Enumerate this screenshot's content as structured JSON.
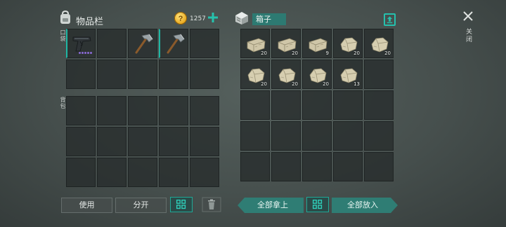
{
  "inventory": {
    "title": "物品栏",
    "gold": "1257",
    "pocket_label": "口袋",
    "backpack_label": "背包",
    "pocket_slots": [
      {
        "item": "pistol",
        "qty": "",
        "selected": true
      },
      {
        "item": "",
        "qty": ""
      },
      {
        "item": "hatchet",
        "qty": ""
      },
      {
        "item": "hatchet",
        "qty": "",
        "selected": true
      },
      {
        "item": "",
        "qty": ""
      },
      {
        "item": "",
        "qty": ""
      },
      {
        "item": "",
        "qty": ""
      },
      {
        "item": "",
        "qty": ""
      },
      {
        "item": "",
        "qty": ""
      },
      {
        "item": "",
        "qty": ""
      }
    ],
    "backpack_slot_count": 15
  },
  "box": {
    "title": "箱子",
    "slots": [
      {
        "item": "stone-brick",
        "qty": "20"
      },
      {
        "item": "stone-brick",
        "qty": "20"
      },
      {
        "item": "stone-brick",
        "qty": "9"
      },
      {
        "item": "stone-rock",
        "qty": "20"
      },
      {
        "item": "stone-rock",
        "qty": "20"
      },
      {
        "item": "stone-rock",
        "qty": "20"
      },
      {
        "item": "stone-rock",
        "qty": "20"
      },
      {
        "item": "stone-rock",
        "qty": "20"
      },
      {
        "item": "stone-rock",
        "qty": "13"
      },
      {
        "item": "",
        "qty": ""
      }
    ],
    "slot_count": 25
  },
  "buttons": {
    "use": "使用",
    "split": "分开",
    "take_all": "全部拿上",
    "put_all": "全部放入",
    "close": "关闭"
  },
  "colors": {
    "accent": "#1fb7a4",
    "button_teal": "#2f7d74",
    "gold": "#e6a61c"
  },
  "icons": {
    "bag": "backpack-icon",
    "coin": "gold-coin-icon",
    "add": "plus-icon",
    "box": "storage-box-icon",
    "upload": "upload-icon",
    "close": "close-x-icon",
    "sort": "sort-grid-icon",
    "trash": "trash-icon"
  }
}
